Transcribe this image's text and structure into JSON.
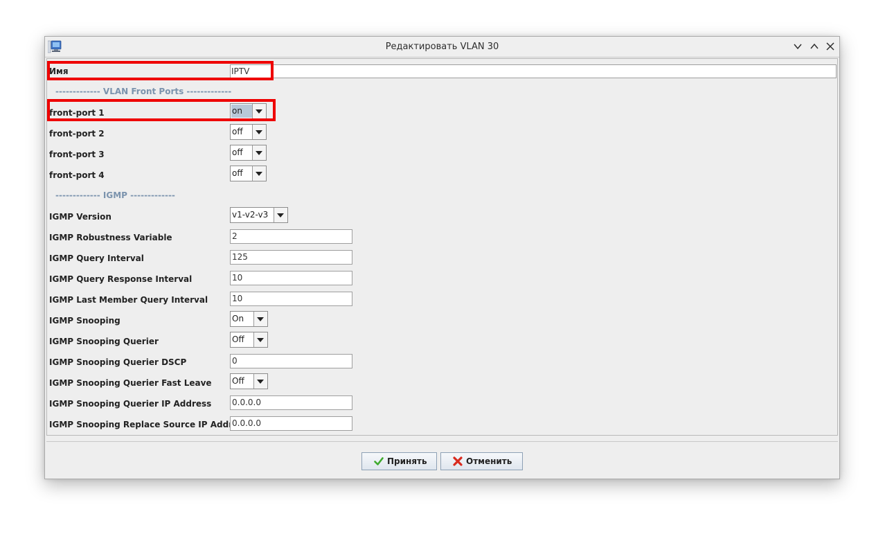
{
  "window": {
    "title": "Редактировать VLAN 30"
  },
  "form": {
    "name": {
      "label": "Имя",
      "value": "IPTV"
    },
    "front_ports_section": "------------- VLAN Front Ports -------------",
    "front_ports": [
      {
        "label": "front-port 1",
        "value": "on"
      },
      {
        "label": "front-port 2",
        "value": "off"
      },
      {
        "label": "front-port 3",
        "value": "off"
      },
      {
        "label": "front-port 4",
        "value": "off"
      }
    ],
    "igmp_section": "------------- IGMP -------------",
    "igmp": {
      "version": {
        "label": "IGMP Version",
        "value": "v1-v2-v3"
      },
      "robustness": {
        "label": "IGMP Robustness Variable",
        "value": "2"
      },
      "query_interval": {
        "label": "IGMP Query Interval",
        "value": "125"
      },
      "query_response_interval": {
        "label": "IGMP Query Response Interval",
        "value": "10"
      },
      "last_member_query_interval": {
        "label": "IGMP Last Member Query Interval",
        "value": "10"
      },
      "snooping": {
        "label": "IGMP Snooping",
        "value": "On"
      },
      "snooping_querier": {
        "label": "IGMP Snooping Querier",
        "value": "Off"
      },
      "snooping_querier_dscp": {
        "label": "IGMP Snooping Querier DSCP",
        "value": "0"
      },
      "snooping_querier_fast_leave": {
        "label": "IGMP Snooping Querier Fast Leave",
        "value": "Off"
      },
      "snooping_querier_ip": {
        "label": "IGMP Snooping Querier IP Address",
        "value": "0.0.0.0"
      },
      "snooping_replace_source_ip": {
        "label": "IGMP Snooping Replace Source IP Address",
        "value": "0.0.0.0"
      }
    }
  },
  "buttons": {
    "accept": "Принять",
    "cancel": "Отменить"
  },
  "icons": {
    "app": "network-app-icon",
    "minimize": "chevron-down-icon",
    "maximize": "chevron-up-icon",
    "close": "close-icon",
    "accept": "checkmark-icon",
    "cancel": "red-x-icon"
  },
  "colors": {
    "highlight": "#ee0000",
    "section_text": "#7b93ad",
    "window_bg": "#eeeeee"
  }
}
